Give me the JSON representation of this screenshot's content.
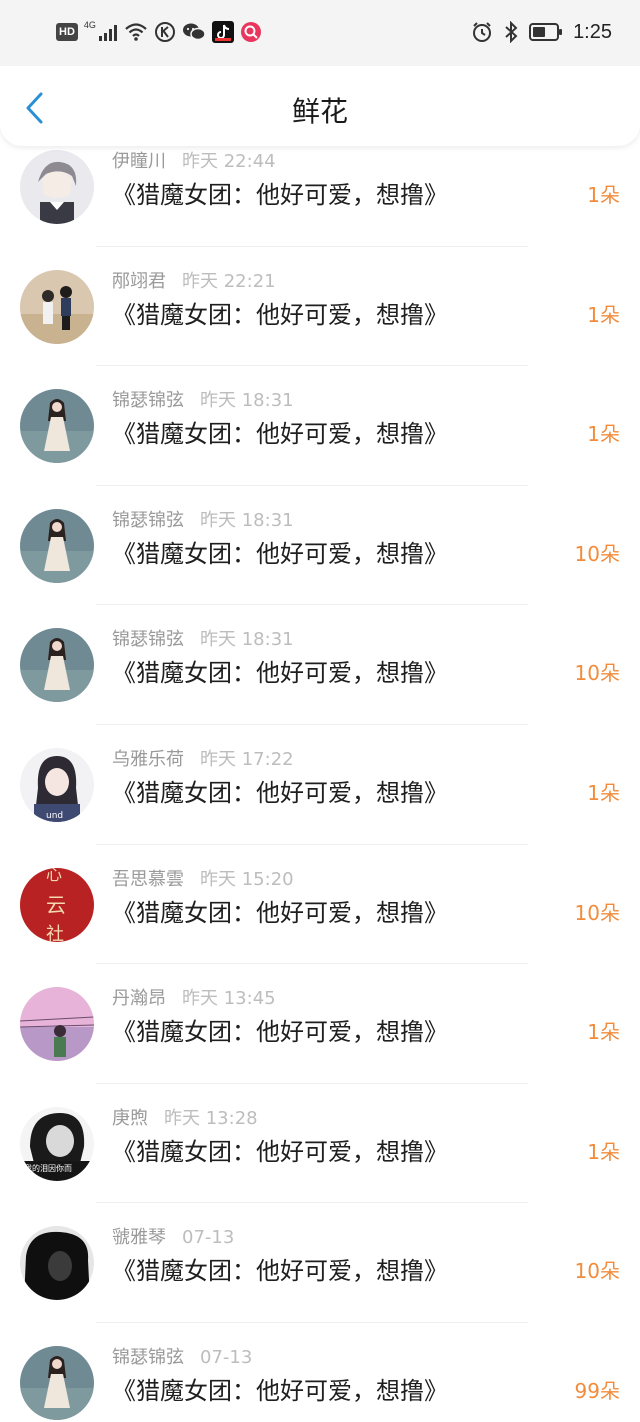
{
  "status_bar": {
    "hd": "HD",
    "signal_label": "4G",
    "time": "1:25",
    "left_icons": [
      "signal-icon",
      "wifi-icon",
      "k-app-icon",
      "wechat-icon",
      "tiktok-icon",
      "red-app-icon"
    ],
    "right_icons": [
      "alarm-icon",
      "bluetooth-icon",
      "battery-icon"
    ]
  },
  "header": {
    "title": "鲜花",
    "back_icon": "chevron-left-icon"
  },
  "colors": {
    "accent": "#2b8fd6",
    "count": "#f28c3c",
    "name": "#9a9a9a",
    "time": "#bdbdbd"
  },
  "items": [
    {
      "name": "伊瞳川",
      "time": "昨天 22:44",
      "book": "《猎魔女团：他好可爱，想撸》",
      "count": "1朵",
      "avatar": "avatar-anime-boy"
    },
    {
      "name": "邴翊君",
      "time": "昨天 22:21",
      "book": "《猎魔女团：他好可爱，想撸》",
      "count": "1朵",
      "avatar": "avatar-couple"
    },
    {
      "name": "锦瑟锦弦",
      "time": "昨天 18:31",
      "book": "《猎魔女团：他好可爱，想撸》",
      "count": "1朵",
      "avatar": "avatar-girl-dress"
    },
    {
      "name": "锦瑟锦弦",
      "time": "昨天 18:31",
      "book": "《猎魔女团：他好可爱，想撸》",
      "count": "10朵",
      "avatar": "avatar-girl-dress"
    },
    {
      "name": "锦瑟锦弦",
      "time": "昨天 18:31",
      "book": "《猎魔女团：他好可爱，想撸》",
      "count": "10朵",
      "avatar": "avatar-girl-dress"
    },
    {
      "name": "乌雅乐荷",
      "time": "昨天 17:22",
      "book": "《猎魔女团：他好可爱，想撸》",
      "count": "1朵",
      "avatar": "avatar-girl-hoodie"
    },
    {
      "name": "吾思慕雲",
      "time": "昨天 15:20",
      "book": "《猎魔女团：他好可爱，想撸》",
      "count": "10朵",
      "avatar": "avatar-red-calligraphy"
    },
    {
      "name": "丹瀚昂",
      "time": "昨天 13:45",
      "book": "《猎魔女团：他好可爱，想撸》",
      "count": "1朵",
      "avatar": "avatar-pink-sky"
    },
    {
      "name": "庚煦",
      "time": "昨天 13:28",
      "book": "《猎魔女团：他好可爱，想撸》",
      "count": "1朵",
      "avatar": "avatar-bw-boy"
    },
    {
      "name": "虢雅琴",
      "time": "07-13",
      "book": "《猎魔女团：他好可爱，想撸》",
      "count": "10朵",
      "avatar": "avatar-dark-hair"
    },
    {
      "name": "锦瑟锦弦",
      "time": "07-13",
      "book": "《猎魔女团：他好可爱，想撸》",
      "count": "99朵",
      "avatar": "avatar-girl-dress"
    }
  ]
}
